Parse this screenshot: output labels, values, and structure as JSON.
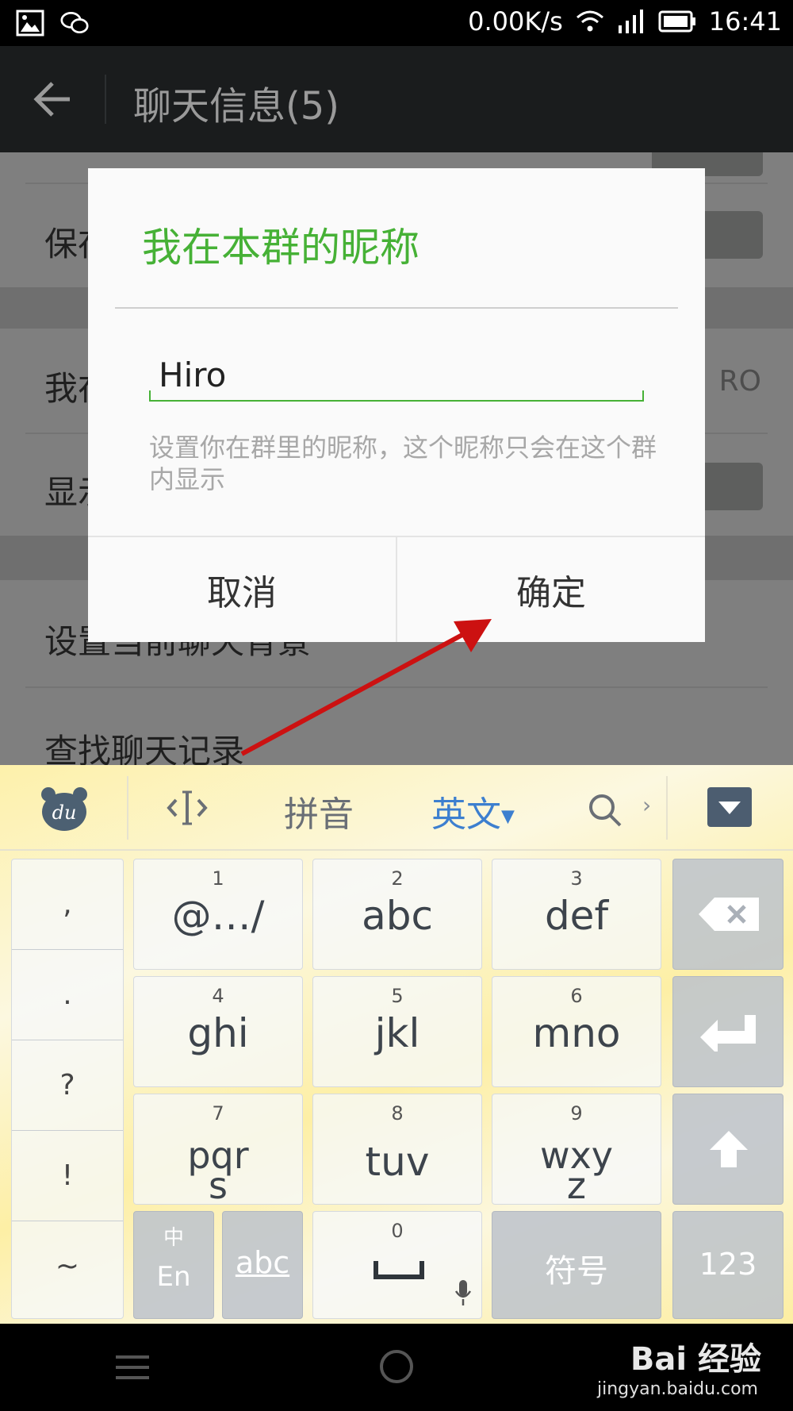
{
  "status_bar": {
    "network_speed": "0.00K/s",
    "time": "16:41",
    "icons": [
      "gallery-icon",
      "wechat-icon",
      "wifi-icon",
      "signal-icon",
      "battery-icon"
    ]
  },
  "header": {
    "title": "聊天信息(5)"
  },
  "settings": {
    "row1_label": "保存",
    "row2_label": "我在",
    "row2_value": "RO",
    "row3_label": "显示",
    "row4_label": "设置当前聊天背景",
    "row5_label": "查找聊天记录"
  },
  "dialog": {
    "title": "我在本群的昵称",
    "input_value": "Hiro",
    "hint": "设置你在群里的昵称，这个昵称只会在这个群内显示",
    "cancel_label": "取消",
    "confirm_label": "确定"
  },
  "keyboard": {
    "tabs": {
      "pinyin": "拼音",
      "english": "英文"
    },
    "punctuation": [
      ",",
      ".",
      "?",
      "!",
      "~"
    ],
    "keys": [
      {
        "num": "1",
        "label": "@…/"
      },
      {
        "num": "2",
        "label": "abc"
      },
      {
        "num": "3",
        "label": "def"
      },
      {
        "num": "4",
        "label": "ghi"
      },
      {
        "num": "5",
        "label": "jkl"
      },
      {
        "num": "6",
        "label": "mno"
      },
      {
        "num": "7",
        "label": "pqr\ns"
      },
      {
        "num": "8",
        "label": "tuv"
      },
      {
        "num": "9",
        "label": "wxy\nz"
      },
      {
        "num": "0",
        "label": ""
      }
    ],
    "zh_en_top": "中",
    "zh_en_bottom": "En",
    "abc_label": "abc",
    "symbols_label": "符号",
    "numbers_label": "123"
  },
  "watermark": {
    "brand": "Bai 经验",
    "url": "jingyan.baidu.com"
  },
  "colors": {
    "accent_green": "#46b136",
    "annotation_red": "#cc1111",
    "keyboard_accent_blue": "#3d7fcf"
  }
}
